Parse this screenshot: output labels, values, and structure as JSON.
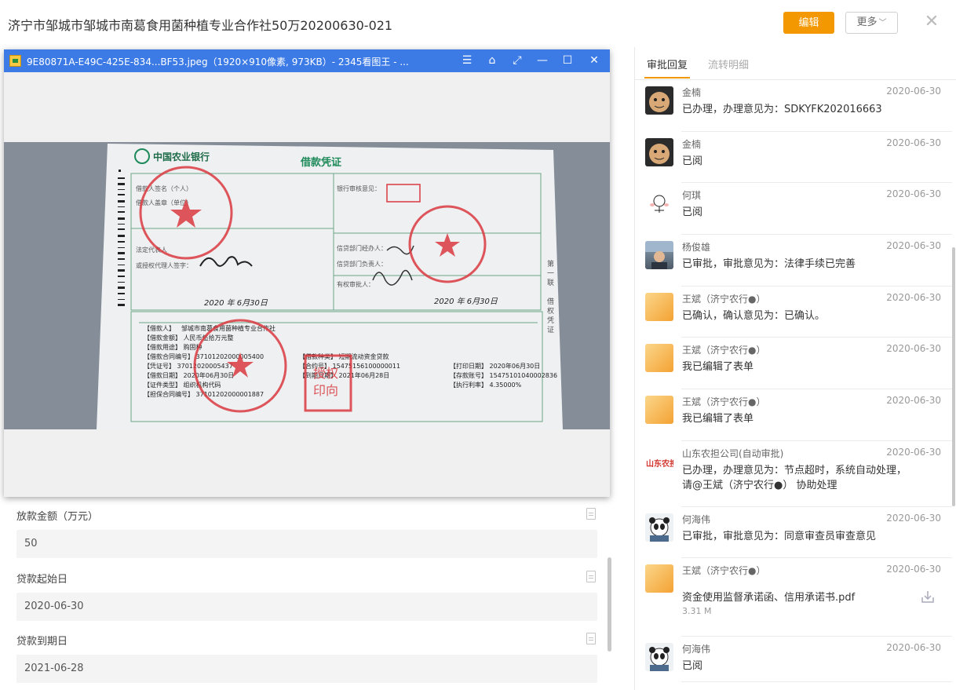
{
  "header": {
    "title": "济宁市邹城市邹城市南葛食用菌种植专业合作社50万20200630-021",
    "edit_label": "编辑",
    "more_label": "更多",
    "close_icon": "close-icon"
  },
  "form": {
    "fields": [
      {
        "label": "放款金额（万元）",
        "value": "50"
      },
      {
        "label": "贷款起始日",
        "value": "2020-06-30"
      },
      {
        "label": "贷款到期日",
        "value": "2021-06-28"
      }
    ]
  },
  "viewer": {
    "title": "9E80871A-E49C-425E-834...BF53.jpeg（1920×910像素, 973KB）- 2345看图王 - ...",
    "buttons": [
      "menu-icon",
      "shirt-icon",
      "fullscreen-icon",
      "minimize-icon",
      "maximize-icon",
      "close-icon"
    ],
    "document": {
      "bank": "中国农业银行",
      "doc_title": "借款凭证",
      "borrower": "邹城市南葛食用菌种植专业合作社",
      "sign_date": "2020 年 6月30日"
    }
  },
  "panel": {
    "tabs": [
      {
        "label": "审批回复",
        "active": true
      },
      {
        "label": "流转明细",
        "active": false
      }
    ],
    "records": [
      {
        "name": "金楠",
        "date": "2020-06-30",
        "text": "已办理，办理意见为：SDKYFK202016663",
        "avatar": "av-brown"
      },
      {
        "name": "金楠",
        "date": "2020-06-30",
        "text": "已阅",
        "avatar": "av-brown"
      },
      {
        "name": "何琪",
        "date": "2020-06-30",
        "text": "已阅",
        "avatar": "av-white"
      },
      {
        "name": "杨俊雄",
        "date": "2020-06-30",
        "text": "已审批，审批意见为：法律手续已完善",
        "avatar": "av-photo"
      },
      {
        "name": "王斌（济宁农行●）",
        "date": "2020-06-30",
        "text": "已确认，确认意见为：已确认。",
        "avatar": "av-orange"
      },
      {
        "name": "王斌（济宁农行●）",
        "date": "2020-06-30",
        "text": "我已编辑了表单",
        "avatar": "av-orange"
      },
      {
        "name": "王斌（济宁农行●）",
        "date": "2020-06-30",
        "text": "我已编辑了表单",
        "avatar": "av-orange"
      },
      {
        "name": "山东农担公司(自动审批)",
        "date": "2020-06-30",
        "text": "已办理，办理意见为：节点超时，系统自动处理，",
        "text2": "请@王斌（济宁农行●） 协助处理",
        "avatar": "av-logo"
      },
      {
        "name": "何海伟",
        "date": "2020-06-30",
        "text": "已审批，审批意见为：同意审查员审查意见",
        "avatar": "av-panda"
      },
      {
        "name": "王斌（济宁农行●）",
        "date": "2020-06-30",
        "text": "资金使用监督承诺函、信用承诺书.pdf",
        "size": "3.31 M",
        "avatar": "av-orange"
      },
      {
        "name": "何海伟",
        "date": "2020-06-30",
        "text": "已阅",
        "avatar": "av-panda"
      }
    ]
  }
}
